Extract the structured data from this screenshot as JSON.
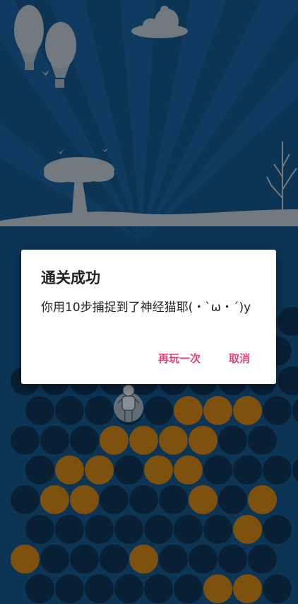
{
  "dialog": {
    "title": "通关成功",
    "message": "你用10步捕捉到了神经猫耶(・`ω・´)y",
    "replay_label": "再玩一次",
    "cancel_label": "取消"
  },
  "board": {
    "rows": [
      "-0000000000",
      "000000000",
      "00000000000",
      "000001110000",
      "000111100",
      "0110110000",
      "011000101",
      "000000010",
      "100010000",
      "000000110"
    ]
  },
  "colors": {
    "background": "#0e4068",
    "empty_cell": "#0c2740",
    "blocked_cell": "#9a6313",
    "accent": "#e8427c"
  },
  "icons": [
    "balloon-icon",
    "cloud-icon",
    "bird-icon",
    "tree-icon",
    "bare-tree-icon",
    "cat-icon"
  ]
}
